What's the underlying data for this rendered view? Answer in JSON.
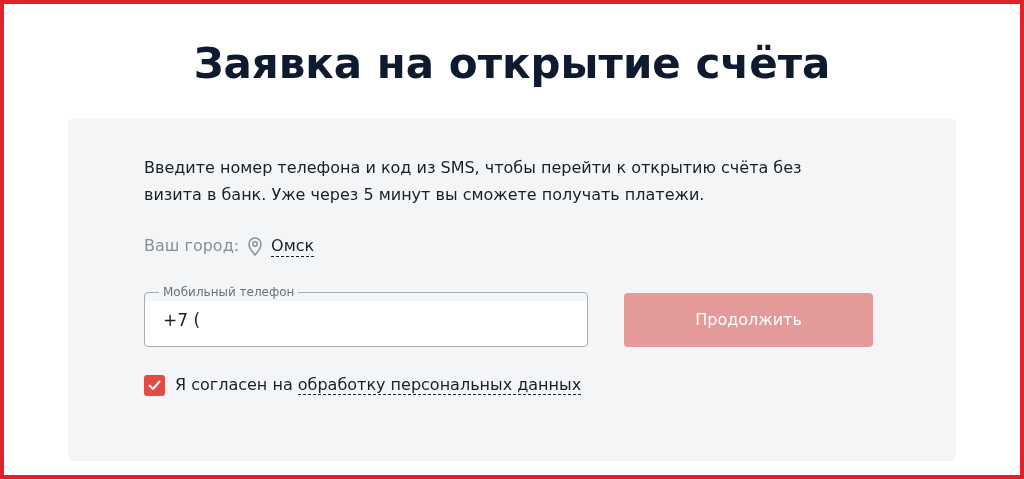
{
  "title": "Заявка на открытие счёта",
  "intro": "Введите номер телефона и код из SMS, чтобы перейти к открытию счёта без визита в банк. Уже через 5 минут вы сможете получать платежи.",
  "city": {
    "label": "Ваш город:",
    "value": "Омск"
  },
  "phone_field": {
    "label": "Мобильный телефон",
    "value": "+7 ("
  },
  "continue_button": {
    "label": "Продолжить",
    "disabled": true
  },
  "consent": {
    "checked": true,
    "text": "Я согласен на",
    "link": "обработку персональных данных"
  }
}
